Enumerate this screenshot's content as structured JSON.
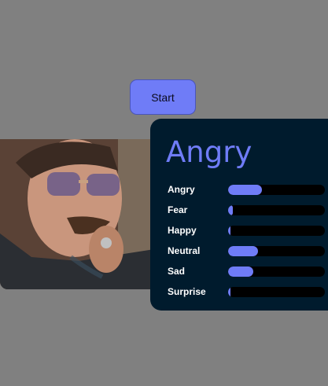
{
  "start_button": {
    "label": "Start"
  },
  "result": {
    "dominant_emotion": "Angry"
  },
  "colors": {
    "accent": "#6f7cf7",
    "panel_bg": "#001b2d",
    "track_bg": "#000000",
    "page_bg": "#808080"
  },
  "emotions": [
    {
      "label": "Angry",
      "level": 0.35
    },
    {
      "label": "Fear",
      "level": 0.05
    },
    {
      "label": "Happy",
      "level": 0.02
    },
    {
      "label": "Neutral",
      "level": 0.31
    },
    {
      "label": "Sad",
      "level": 0.26
    },
    {
      "label": "Surprise",
      "level": 0.01
    }
  ]
}
